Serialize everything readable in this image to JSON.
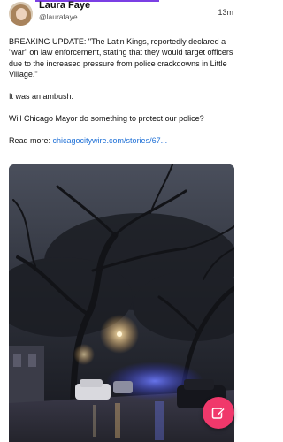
{
  "post": {
    "author_name": "Laura Faye",
    "author_handle": "@laurafaye",
    "timestamp": "13m",
    "paragraphs": [
      "BREAKING UPDATE: \"The Latin Kings, reportedly declared a \"war\" on law enforcement, stating that they would target officers due to the increased pressure from police crackdowns in Little Village.\"",
      "It was an ambush.",
      "Will Chicago Mayor do something to protect our police?"
    ],
    "read_more_label": "Read more: ",
    "read_more_link": "chicagocitywire.com/stories/67..."
  },
  "icons": {
    "compose": "compose-icon"
  },
  "colors": {
    "accent": "#7b3fe4",
    "link": "#1d6fd6",
    "fab": "#f0386b"
  }
}
